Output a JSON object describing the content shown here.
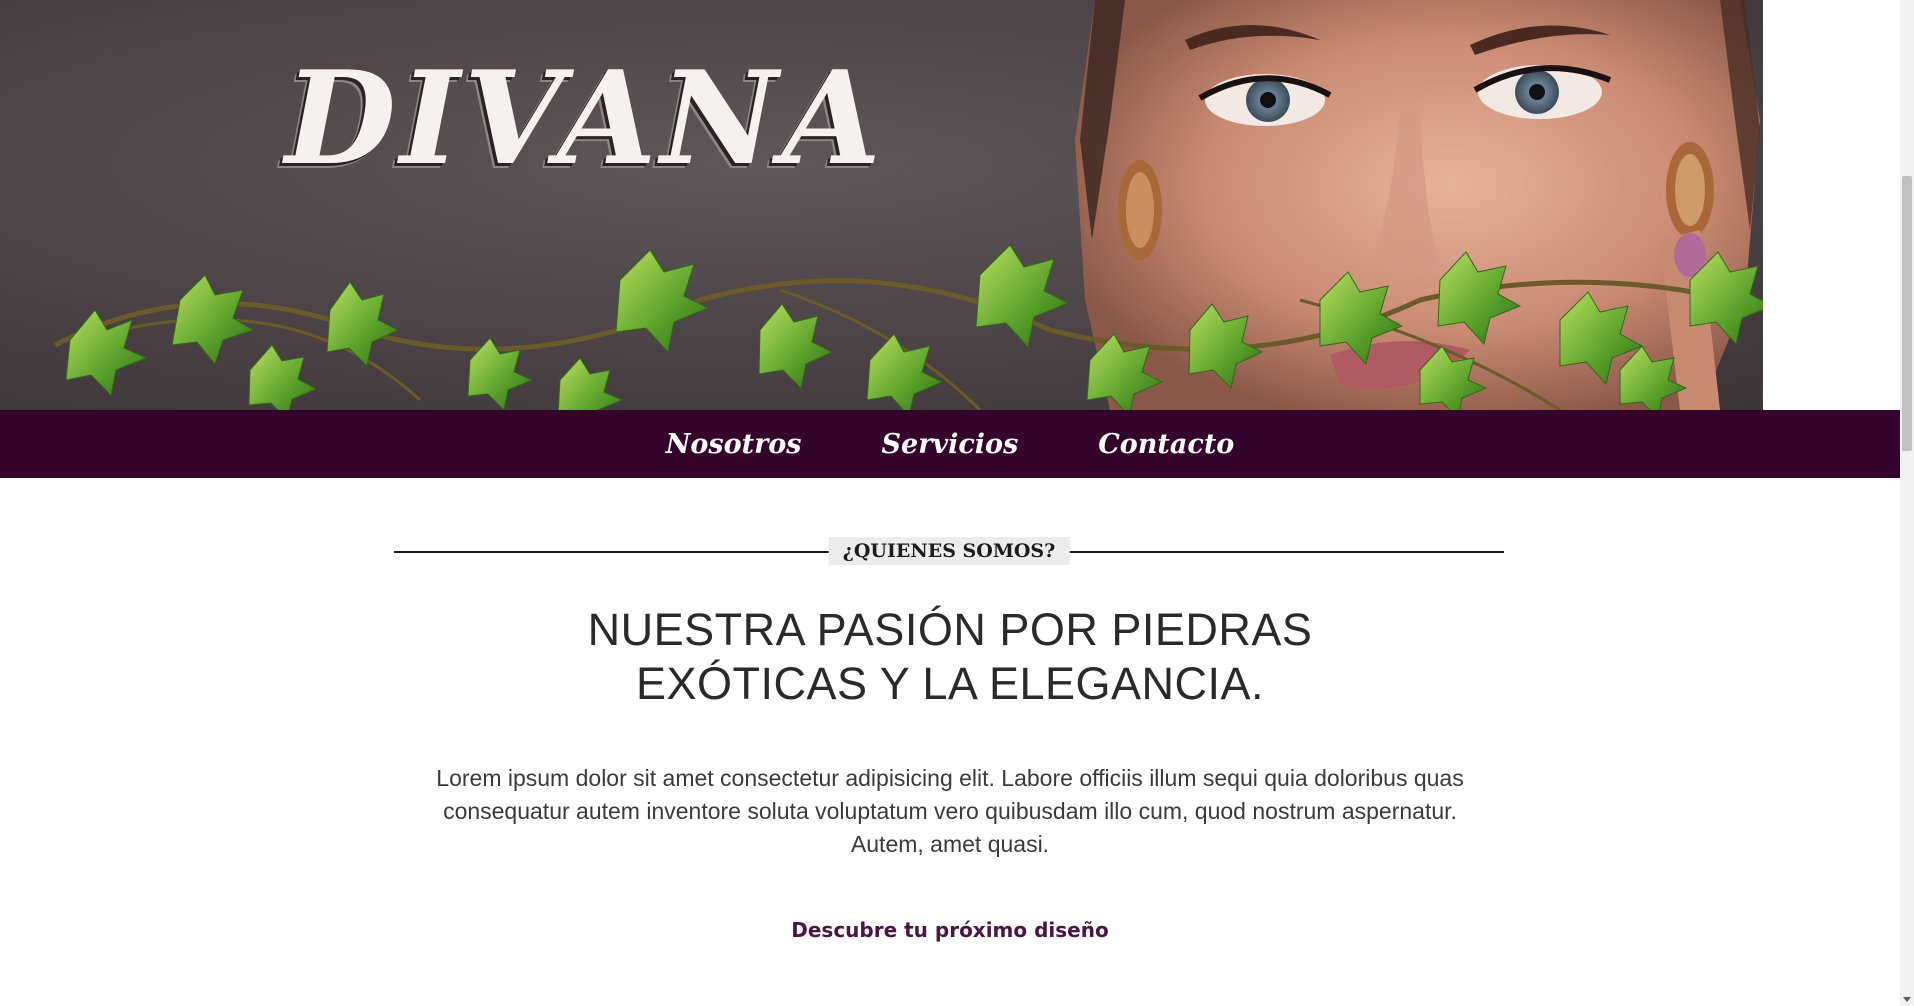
{
  "brand": {
    "logo_text": "DIVANA"
  },
  "nav": {
    "items": [
      {
        "label": "Nosotros"
      },
      {
        "label": "Servicios"
      },
      {
        "label": "Contacto"
      }
    ]
  },
  "about": {
    "section_label": "¿QUIENES SOMOS?",
    "headline_line1": "NUESTRA PASIÓN POR PIEDRAS",
    "headline_line2": "EXÓTICAS Y LA ELEGANCIA.",
    "body_line1": "Lorem ipsum dolor sit amet consectetur adipisicing elit. Labore officiis illum sequi quia doloribus quas",
    "body_line2": "consequatur autem inventore soluta voluptatum vero quibusdam illo cum, quod nostrum aspernatur.",
    "body_line3": "Autem, amet quasi.",
    "cta_label": "Descubre tu próximo diseño"
  },
  "colors": {
    "nav_background": "#34042c",
    "accent": "#4a1443",
    "hero_background": "#4a4244"
  }
}
